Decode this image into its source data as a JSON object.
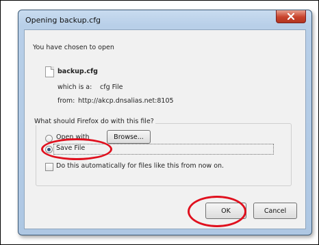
{
  "dialog": {
    "title": "Opening backup.cfg",
    "intro": "You have chosen to open",
    "file_name": "backup.cfg",
    "type_label": "which is a:",
    "type_value": "cfg File",
    "from_label": "from:",
    "from_value": "http://akcp.dnsalias.net:8105",
    "question": "What should Firefox do with this file?",
    "open_with_label": "Open with",
    "browse_label": "Browse...",
    "save_file_label": "Save File",
    "save_file_selected": true,
    "auto_label": "Do this automatically for files like this from now on.",
    "auto_checked": false,
    "ok_label": "OK",
    "cancel_label": "Cancel"
  },
  "colors": {
    "annotation": "#e0101e",
    "title_gradient": "#c9dcf0",
    "close_button": "#c8432c",
    "client_bg": "#f1f1f1"
  },
  "icons": {
    "close": "close-icon",
    "file": "file-icon"
  }
}
